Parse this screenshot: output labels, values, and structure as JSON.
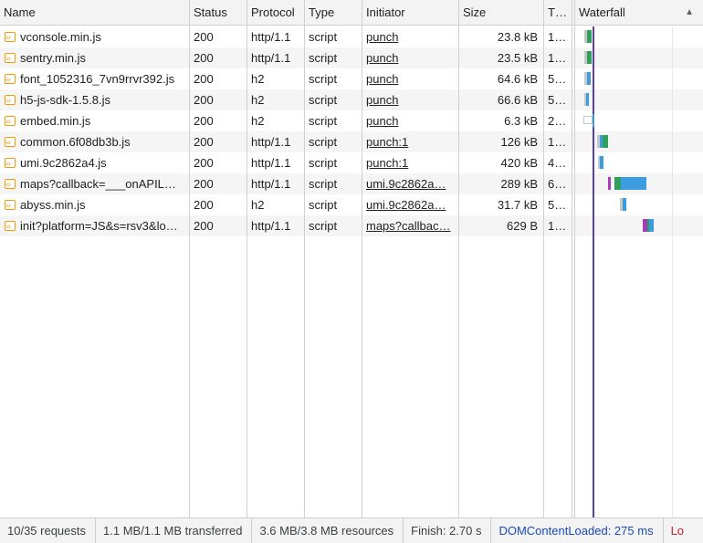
{
  "columns": {
    "name": "Name",
    "status": "Status",
    "protocol": "Protocol",
    "type": "Type",
    "initiator": "Initiator",
    "size": "Size",
    "time": "T…",
    "waterfall": "Waterfall",
    "sort_icon": "▲"
  },
  "rows": [
    {
      "name": "vconsole.min.js",
      "status": "200",
      "protocol": "http/1.1",
      "type": "script",
      "initiator": "punch",
      "size": "23.8 kB",
      "time": "1…"
    },
    {
      "name": "sentry.min.js",
      "status": "200",
      "protocol": "http/1.1",
      "type": "script",
      "initiator": "punch",
      "size": "23.5 kB",
      "time": "1…"
    },
    {
      "name": "font_1052316_7vn9rrvr392.js",
      "status": "200",
      "protocol": "h2",
      "type": "script",
      "initiator": "punch",
      "size": "64.6 kB",
      "time": "5…"
    },
    {
      "name": "h5-js-sdk-1.5.8.js",
      "status": "200",
      "protocol": "h2",
      "type": "script",
      "initiator": "punch",
      "size": "66.6 kB",
      "time": "5…"
    },
    {
      "name": "embed.min.js",
      "status": "200",
      "protocol": "h2",
      "type": "script",
      "initiator": "punch",
      "size": "6.3 kB",
      "time": "2…"
    },
    {
      "name": "common.6f08db3b.js",
      "status": "200",
      "protocol": "http/1.1",
      "type": "script",
      "initiator": "punch:1",
      "size": "126 kB",
      "time": "1…"
    },
    {
      "name": "umi.9c2862a4.js",
      "status": "200",
      "protocol": "http/1.1",
      "type": "script",
      "initiator": "punch:1",
      "size": "420 kB",
      "time": "4…"
    },
    {
      "name": "maps?callback=___onAPIL…",
      "status": "200",
      "protocol": "http/1.1",
      "type": "script",
      "initiator": "umi.9c2862a…",
      "size": "289 kB",
      "time": "6…"
    },
    {
      "name": "abyss.min.js",
      "status": "200",
      "protocol": "h2",
      "type": "script",
      "initiator": "umi.9c2862a…",
      "size": "31.7 kB",
      "time": "5…"
    },
    {
      "name": "init?platform=JS&s=rsv3&lo…",
      "status": "200",
      "protocol": "http/1.1",
      "type": "script",
      "initiator": "maps?callbac…",
      "size": "629 B",
      "time": "1…"
    }
  ],
  "colors": {
    "waiting": "#2ea05c",
    "download": "#3b9de0",
    "queue": "#c7c7c7",
    "ssl": "#a33eb8",
    "dcl_line": "#5b3fa8"
  },
  "footer": {
    "requests": "10/35 requests",
    "transferred": "1.1 MB/1.1 MB transferred",
    "resources": "3.6 MB/3.8 MB resources",
    "finish": "Finish: 2.70 s",
    "dom_content_loaded": "DOMContentLoaded: 275 ms",
    "load": "Lo"
  }
}
